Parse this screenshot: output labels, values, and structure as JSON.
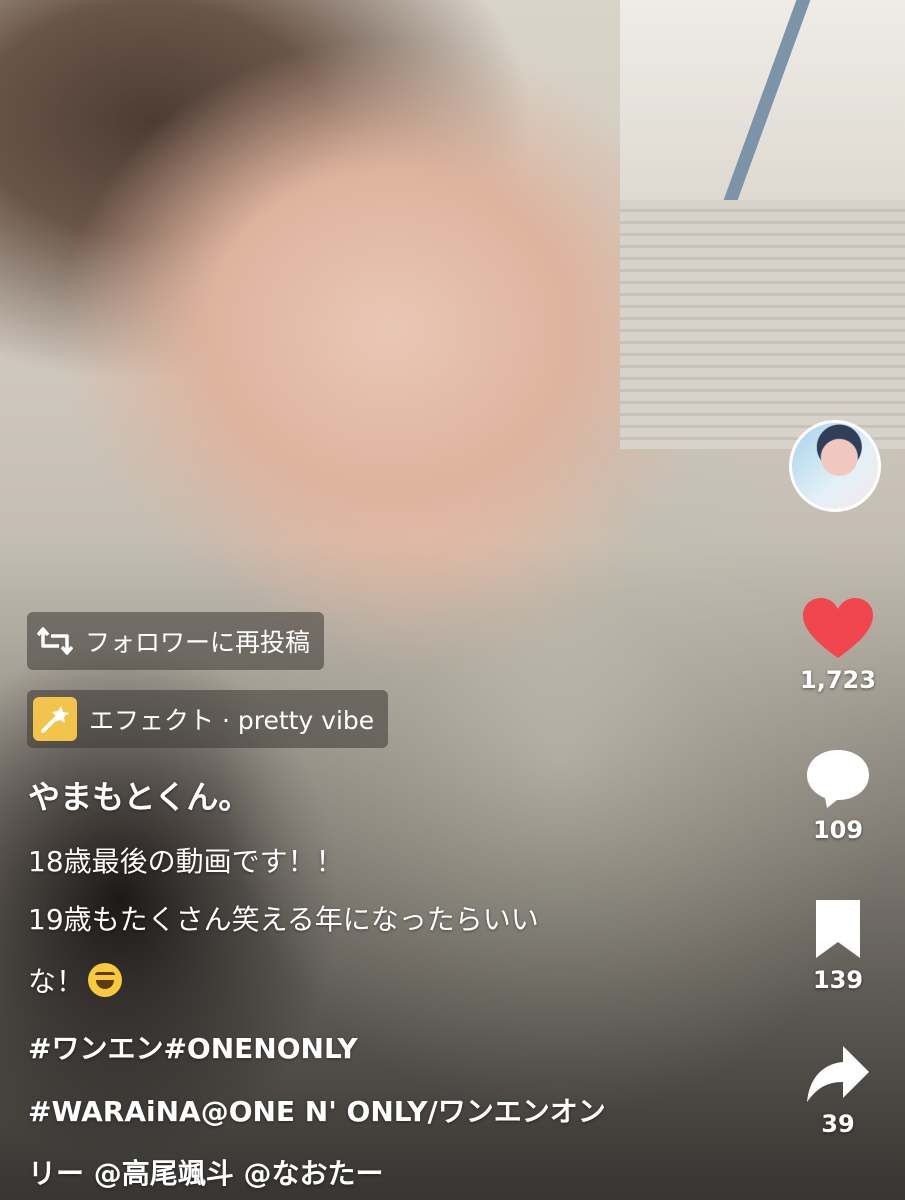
{
  "actions": {
    "likes": "1,723",
    "comments": "109",
    "saves": "139",
    "shares": "39",
    "like_color": "#f2464f"
  },
  "chips": {
    "repost": "フォロワーに再投稿",
    "effect": "エフェクト · pretty vibe"
  },
  "caption": {
    "username": "やまもとくん。",
    "line1": "18歳最後の動画です！！",
    "line2": "19歳もたくさん笑える年になったらいい",
    "line3": "な！",
    "line4": "#ワンエン#ONENONLY",
    "line5": "#WARAiNA@ONE N' ONLY/ワンエンオン",
    "line6": "リー @高尾颯斗 @なおたー"
  },
  "icons": [
    "creator-avatar",
    "heart-icon",
    "comment-icon",
    "bookmark-icon",
    "share-icon",
    "repost-icon",
    "effect-icon",
    "grin-emoji"
  ]
}
